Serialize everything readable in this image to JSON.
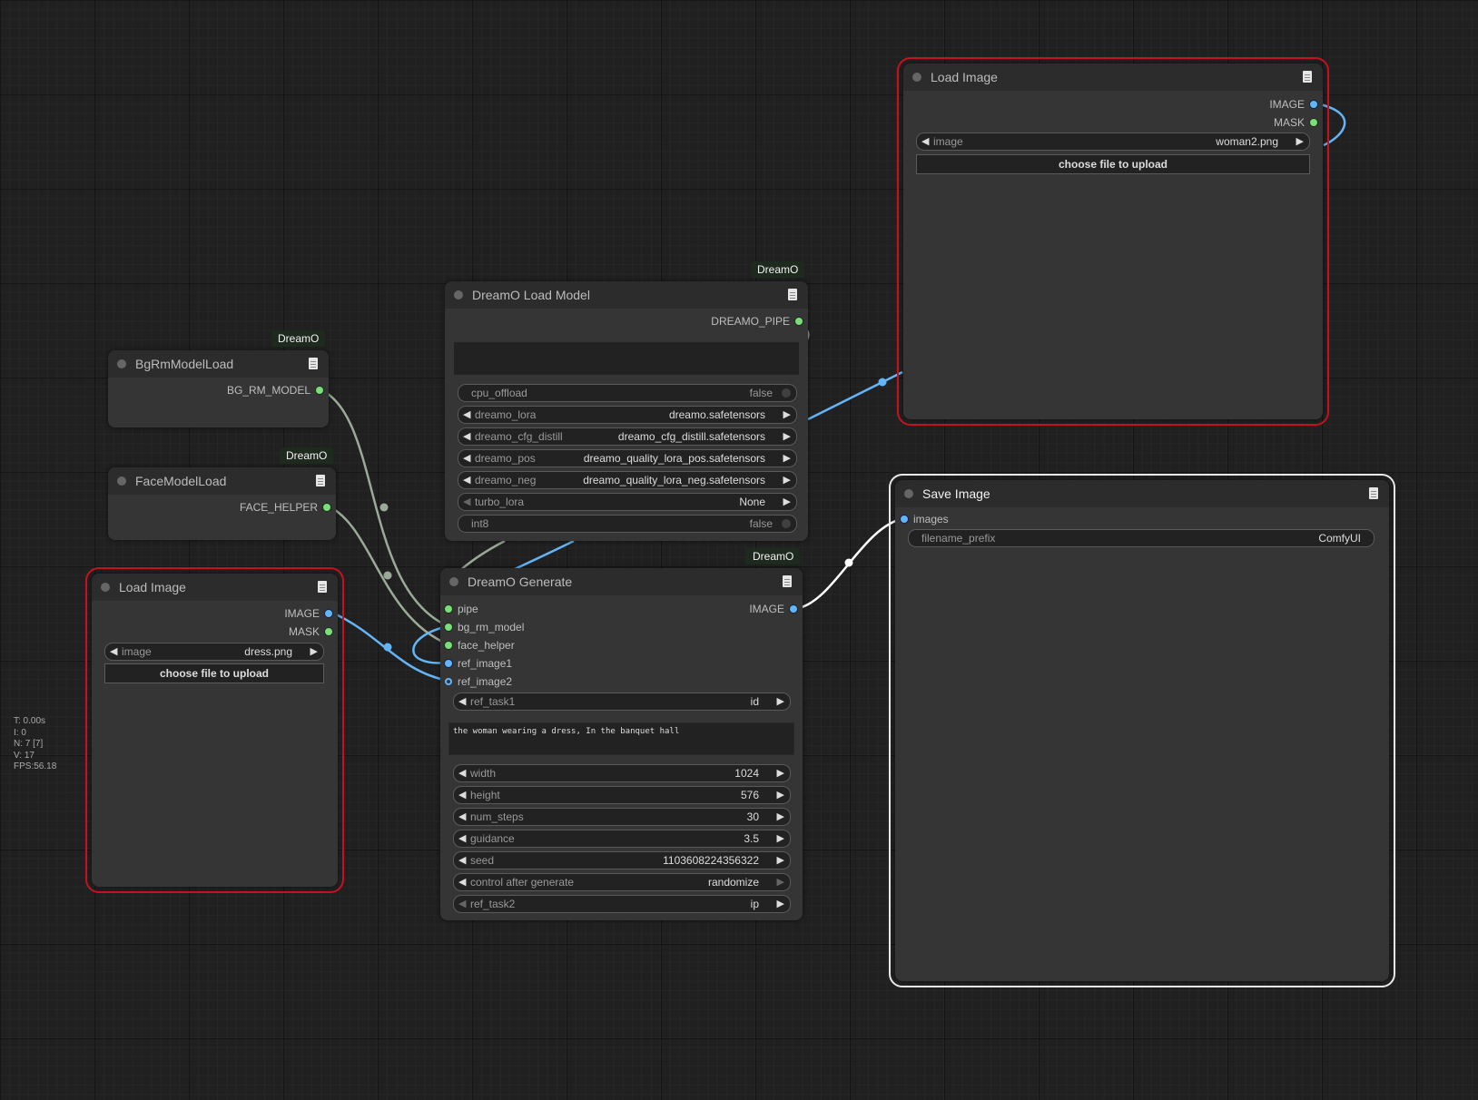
{
  "stats": {
    "t": "T: 0.00s",
    "i": "I: 0",
    "n": "N: 7 [7]",
    "v": "V: 17",
    "fps": "FPS:56.18"
  },
  "badge_text": "DreamO",
  "nodes": {
    "load_image_top": {
      "title": "Load Image",
      "outputs": [
        "IMAGE",
        "MASK"
      ],
      "image_widget": {
        "label": "image",
        "value": "woman2.png"
      },
      "upload_button": "choose file to upload"
    },
    "dreamo_load_model": {
      "title": "DreamO Load Model",
      "output": "DREAMO_PIPE",
      "widgets": [
        {
          "label": "cpu_offload",
          "value": "false"
        },
        {
          "label": "dreamo_lora",
          "value": "dreamo.safetensors"
        },
        {
          "label": "dreamo_cfg_distill",
          "value": "dreamo_cfg_distill.safetensors"
        },
        {
          "label": "dreamo_pos",
          "value": "dreamo_quality_lora_pos.safetensors"
        },
        {
          "label": "dreamo_neg",
          "value": "dreamo_quality_lora_neg.safetensors"
        },
        {
          "label": "turbo_lora",
          "value": "None"
        },
        {
          "label": "int8",
          "value": "false"
        }
      ]
    },
    "bg_rm_model_load": {
      "title": "BgRmModelLoad",
      "output": "BG_RM_MODEL"
    },
    "face_model_load": {
      "title": "FaceModelLoad",
      "output": "FACE_HELPER"
    },
    "load_image_left": {
      "title": "Load Image",
      "outputs": [
        "IMAGE",
        "MASK"
      ],
      "image_widget": {
        "label": "image",
        "value": "dress.png"
      },
      "upload_button": "choose file to upload"
    },
    "dreamo_generate": {
      "title": "DreamO Generate",
      "inputs": [
        "pipe",
        "bg_rm_model",
        "face_helper",
        "ref_image1",
        "ref_image2"
      ],
      "output": "IMAGE",
      "ref_task1": {
        "label": "ref_task1",
        "value": "id"
      },
      "prompt": "the woman wearing a dress, In the banquet hall",
      "widgets": [
        {
          "label": "width",
          "value": "1024"
        },
        {
          "label": "height",
          "value": "576"
        },
        {
          "label": "num_steps",
          "value": "30"
        },
        {
          "label": "guidance",
          "value": "3.5"
        },
        {
          "label": "seed",
          "value": "1103608224356322"
        },
        {
          "label": "control after generate",
          "value": "randomize"
        },
        {
          "label": "ref_task2",
          "value": "ip"
        }
      ]
    },
    "save_image": {
      "title": "Save Image",
      "input": "images",
      "filename_prefix": {
        "label": "filename_prefix",
        "value": "ComfyUI"
      }
    }
  },
  "colors": {
    "canvas": "#202020",
    "node_body": "#353535",
    "node_title": "#2c2c2c",
    "image_link": "#64b5f6",
    "model_link": "#9aaa98",
    "error_outline": "#c4121f"
  }
}
